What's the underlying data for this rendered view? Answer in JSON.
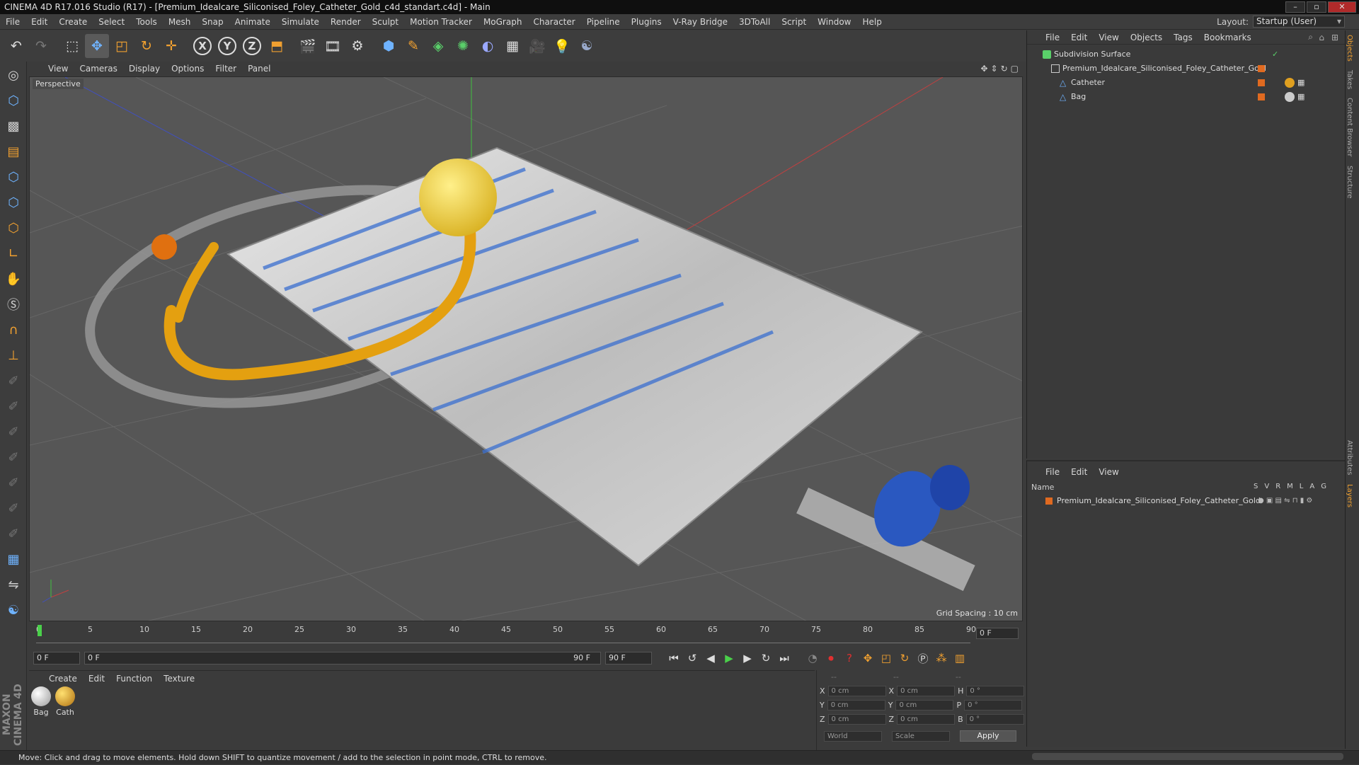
{
  "window": {
    "title": "CINEMA 4D R17.016 Studio (R17) - [Premium_Idealcare_Siliconised_Foley_Catheter_Gold_c4d_standart.c4d] - Main",
    "controls": [
      "–",
      "▫",
      "✕"
    ]
  },
  "menubar": [
    "File",
    "Edit",
    "Create",
    "Select",
    "Tools",
    "Mesh",
    "Snap",
    "Animate",
    "Simulate",
    "Render",
    "Sculpt",
    "Motion Tracker",
    "MoGraph",
    "Character",
    "Pipeline",
    "Plugins",
    "V-Ray Bridge",
    "3DToAll",
    "Script",
    "Window",
    "Help"
  ],
  "layout": {
    "label": "Layout:",
    "value": "Startup (User)"
  },
  "viewport": {
    "menu": [
      "View",
      "Cameras",
      "Display",
      "Options",
      "Filter",
      "Panel"
    ],
    "label": "Perspective",
    "grid_spacing": "Grid Spacing : 10 cm"
  },
  "timeline": {
    "ticks": [
      "0",
      "5",
      "10",
      "15",
      "20",
      "25",
      "30",
      "35",
      "40",
      "45",
      "50",
      "55",
      "60",
      "65",
      "70",
      "75",
      "80",
      "85",
      "90"
    ],
    "current_frame": "0 F",
    "start_field": "0 F",
    "range_start": "0 F",
    "range_end": "90 F",
    "end_field": "90 F"
  },
  "materials": {
    "menu": [
      "Create",
      "Edit",
      "Function",
      "Texture"
    ],
    "items": [
      {
        "label": "Bag",
        "color": "#cfcfcf"
      },
      {
        "label": "Cath",
        "color": "#e0a020"
      }
    ]
  },
  "coords": {
    "headers": [
      "--",
      "--",
      "--"
    ],
    "rows": [
      {
        "a": "X",
        "v1": "0 cm",
        "b": "X",
        "v2": "0 cm",
        "c": "H",
        "v3": "0 °"
      },
      {
        "a": "Y",
        "v1": "0 cm",
        "b": "Y",
        "v2": "0 cm",
        "c": "P",
        "v3": "0 °"
      },
      {
        "a": "Z",
        "v1": "0 cm",
        "b": "Z",
        "v2": "0 cm",
        "c": "B",
        "v3": "0 °"
      }
    ],
    "mode1": "World",
    "mode2": "Scale",
    "apply": "Apply"
  },
  "objects": {
    "menu": [
      "File",
      "Edit",
      "View",
      "Objects",
      "Tags",
      "Bookmarks"
    ],
    "rows": [
      {
        "name": "Subdivision Surface",
        "indent": 0
      },
      {
        "name": "Premium_Idealcare_Siliconised_Foley_Catheter_Gold",
        "indent": 1
      },
      {
        "name": "Catheter",
        "indent": 2
      },
      {
        "name": "Bag",
        "indent": 2
      }
    ]
  },
  "layers": {
    "menu": [
      "File",
      "Edit",
      "View"
    ],
    "name_header": "Name",
    "col_headers": [
      "S",
      "V",
      "R",
      "M",
      "L",
      "A",
      "G"
    ],
    "row": "Premium_Idealcare_Siliconised_Foley_Catheter_Gold"
  },
  "side_tabs": [
    "Objects",
    "Takes",
    "Content Browser",
    "Structure",
    "Attributes",
    "Layers"
  ],
  "status": "Move: Click and drag to move elements. Hold down SHIFT to quantize movement / add to the selection in point mode, CTRL to remove."
}
